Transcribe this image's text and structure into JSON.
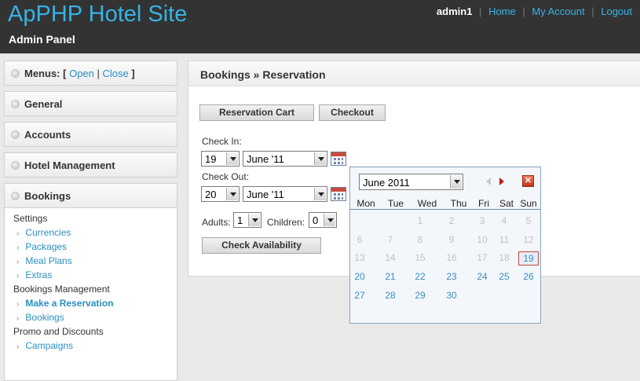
{
  "header": {
    "site_title": "ApPHP Hotel Site",
    "subtitle": "Admin Panel",
    "user": "admin1",
    "links": [
      "Home",
      "My Account",
      "Logout"
    ]
  },
  "sidebar": {
    "menus_label": "Menus: [",
    "menus_open": "Open",
    "menus_sep": "|",
    "menus_close": "Close",
    "menus_end": "]",
    "sections": [
      "General",
      "Accounts",
      "Hotel Management",
      "Bookings"
    ],
    "bookings": {
      "group1": "Settings",
      "group1_items": [
        "Currencies",
        "Packages",
        "Meal Plans",
        "Extras"
      ],
      "group2": "Bookings Management",
      "group2_items": [
        "Make a Reservation",
        "Bookings"
      ],
      "group3": "Promo and Discounts",
      "group3_items": [
        "Campaigns"
      ]
    }
  },
  "main": {
    "breadcrumb": "Bookings » Reservation",
    "btn_cart": "Reservation Cart",
    "btn_checkout": "Checkout",
    "checkin_label": "Check In:",
    "checkin_day": "19",
    "checkin_month": "June '11",
    "checkout_label": "Check Out:",
    "checkout_day": "20",
    "checkout_month": "June '11",
    "adults_label": "Adults:",
    "adults_value": "1",
    "children_label": "Children:",
    "children_value": "0",
    "btn_availability": "Check Availability"
  },
  "calendar": {
    "month": "June 2011",
    "close_glyph": "✕",
    "weekdays": [
      "Mon",
      "Tue",
      "Wed",
      "Thu",
      "Fri",
      "Sat",
      "Sun"
    ],
    "weeks": [
      [
        "",
        "",
        "1",
        "2",
        "3",
        "4",
        "5"
      ],
      [
        "6",
        "7",
        "8",
        "9",
        "10",
        "11",
        "12"
      ],
      [
        "13",
        "14",
        "15",
        "16",
        "17",
        "18",
        "19"
      ],
      [
        "20",
        "21",
        "22",
        "23",
        "24",
        "25",
        "26"
      ],
      [
        "27",
        "28",
        "29",
        "30",
        "",
        "",
        ""
      ]
    ],
    "today": "19",
    "first_selectable": "19",
    "colors": {
      "enabled": "#3a8fc0",
      "disabled": "#c0c0c0",
      "today_border": "#c4453b"
    }
  }
}
